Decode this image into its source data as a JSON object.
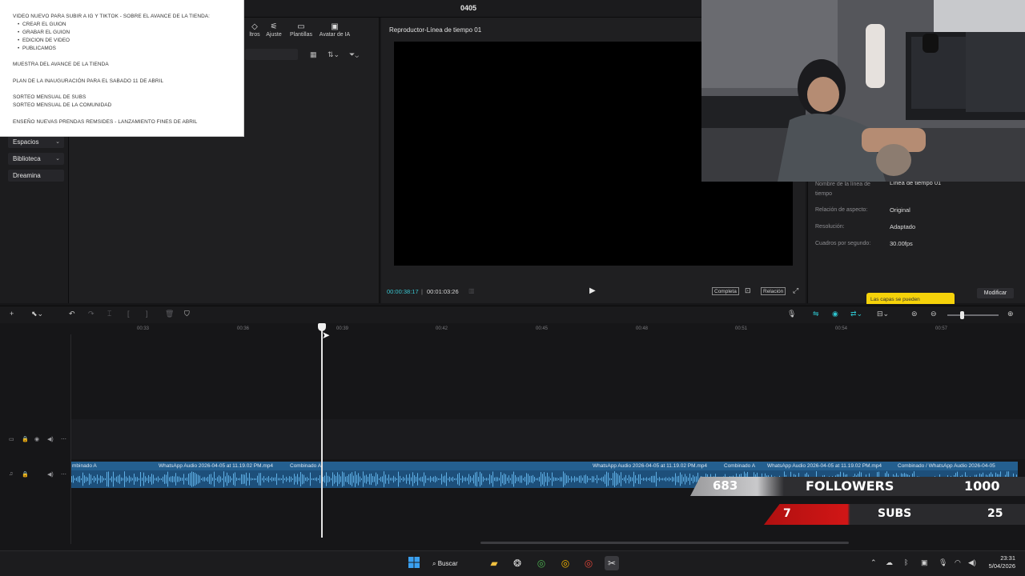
{
  "window": {
    "title": "0405"
  },
  "notes": {
    "title": "VIDEO NUEVO PARA SUBIR A IG Y TIKTOK - SOBRE EL AVANCE DE LA TIENDA:",
    "bullets": [
      "CREAR EL GUION",
      "GRABAR EL GUION",
      "EDICION DE VIDEO",
      "PUBLICAMOS"
    ],
    "line1": "MUESTRA DEL AVANCE DE LA TIENDA",
    "line2": "PLAN DE LA INAUGURACIÓN PARA EL SABADO 11 DE ABRIL",
    "line3": "SORTEO MENSUAL DE SUBS",
    "line4": "SORTEO MENSUAL DE LA COMUNIDAD",
    "line5": "ENSEÑO NUEVAS PRENDAS REMSIDES - LANZAMIENTO FINES DE ABRIL"
  },
  "toolbar": {
    "items": [
      {
        "label": "ltros",
        "icon": "filters-icon"
      },
      {
        "label": "Ajuste",
        "icon": "adjust-icon"
      },
      {
        "label": "Plantillas",
        "icon": "templates-icon"
      },
      {
        "label": "Avatar de IA",
        "icon": "avatar-icon"
      }
    ]
  },
  "sidebar": {
    "items": [
      {
        "label": "Espacios",
        "has_chevron": true
      },
      {
        "label": "Biblioteca",
        "has_chevron": true
      },
      {
        "label": "Dreamina",
        "has_chevron": false
      }
    ]
  },
  "player": {
    "title": "Reproductor-Línea de tiempo 01",
    "current_time": "00:00:38:17",
    "total_time": "00:01:03:26",
    "full_label": "Completa",
    "ratio_label": "Relación"
  },
  "properties": {
    "name_label": "Nombre de la línea de tiempo",
    "name_value": "Línea de tiempo 01",
    "aspect_label": "Relación de aspecto:",
    "aspect_value": "Original",
    "resolution_label": "Resolución:",
    "resolution_value": "Adaptado",
    "fps_label": "Cuadros por segundo:",
    "fps_value": "30.00fps",
    "modify_button": "Modificar",
    "tooltip": "Las capas se pueden"
  },
  "timeline": {
    "ticks": [
      "00:33",
      "00:36",
      "00:39",
      "00:42",
      "00:45",
      "00:48",
      "00:51",
      "00:54",
      "00:57"
    ],
    "clips": [
      "mbinado A",
      "WhatsApp Audio 2026-04-05 at 11.19.02 PM.mp4",
      "Combinado A",
      "WhatsApp Audio 2026-04-05 at 11.19.02 PM.mp4",
      "Combinado A",
      "WhatsApp Audio 2026-04-05 at 11.19.02 PM.mp4",
      "Combinado / WhatsApp Audio 2026-04-05"
    ],
    "clip_color": "#1d4f7a",
    "accent": "#2ec4ce"
  },
  "stats": {
    "followers_current": "683",
    "followers_label": "FOLLOWERS",
    "followers_goal": "1000",
    "subs_current": "7",
    "subs_label": "SUBS",
    "subs_goal": "25"
  },
  "taskbar": {
    "search_label": "Buscar",
    "time": "23:31",
    "date": "5/04/2026"
  }
}
